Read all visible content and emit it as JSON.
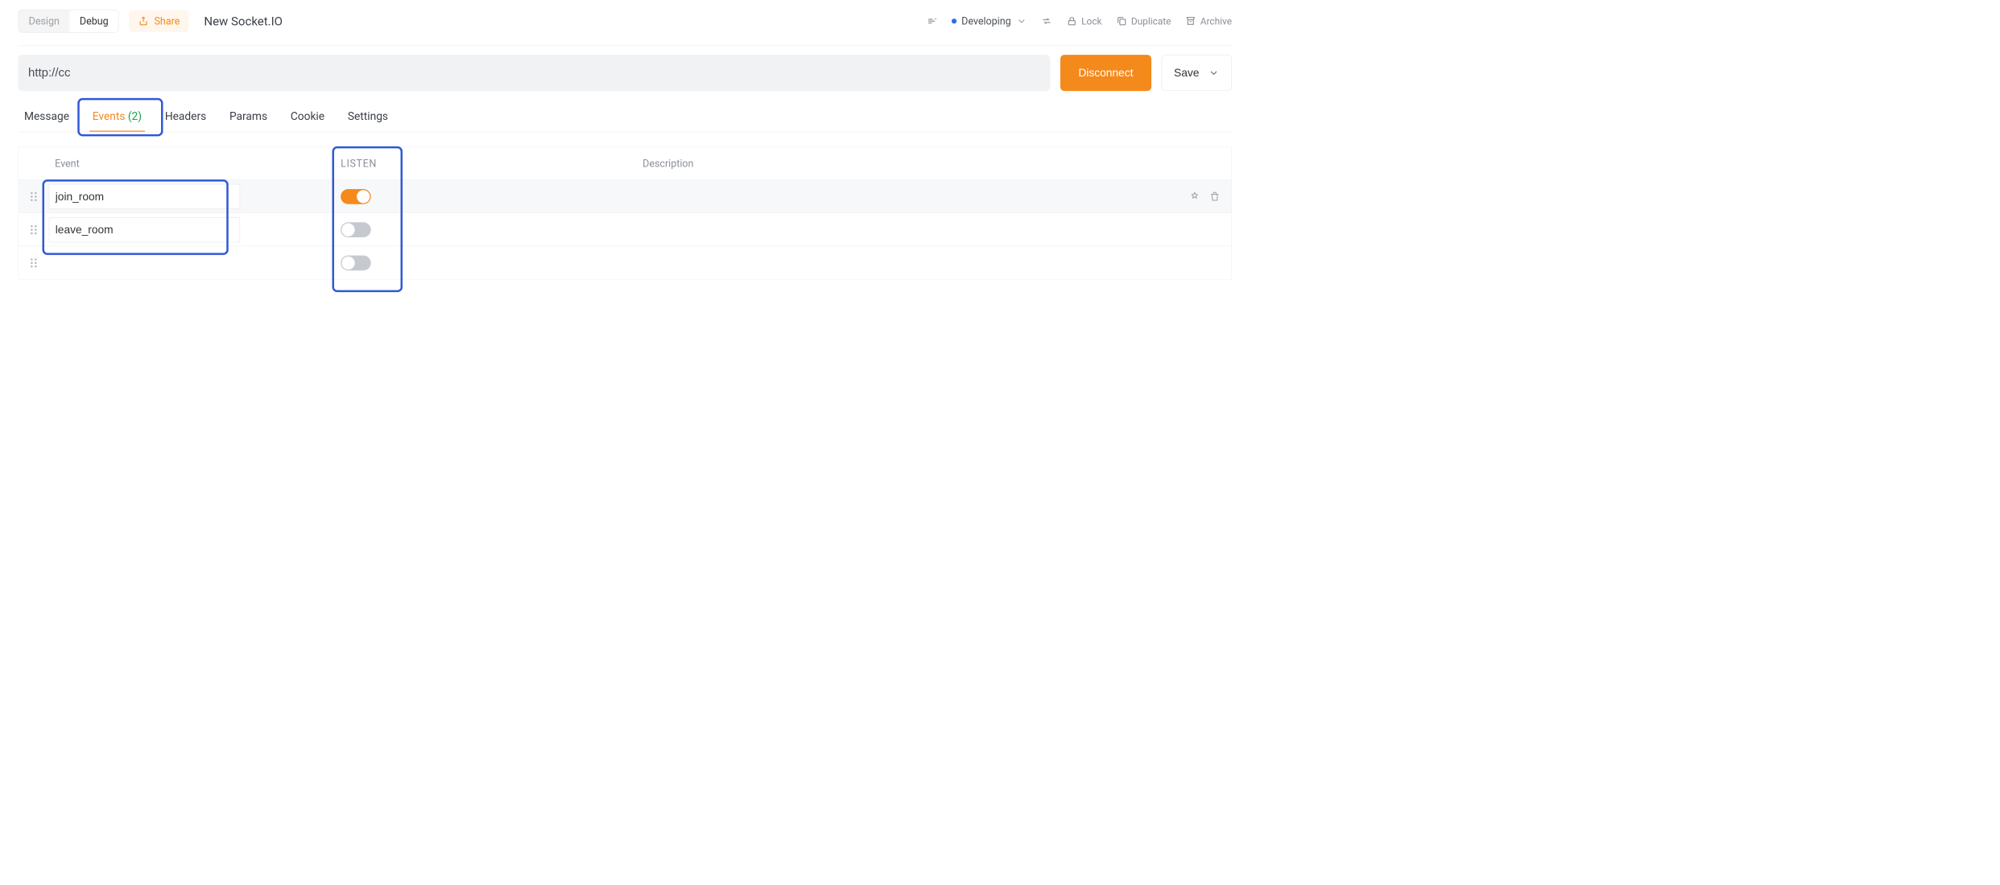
{
  "topbar": {
    "design_label": "Design",
    "debug_label": "Debug",
    "share_label": "Share",
    "title": "New Socket.IO"
  },
  "right": {
    "env_label": "Developing",
    "lock_label": "Lock",
    "duplicate_label": "Duplicate",
    "archive_label": "Archive"
  },
  "url": {
    "value": "http://cc",
    "disconnect_label": "Disconnect",
    "save_label": "Save"
  },
  "tabs": [
    {
      "label": "Message"
    },
    {
      "label": "Events",
      "count": "(2)",
      "active": true
    },
    {
      "label": "Headers"
    },
    {
      "label": "Params"
    },
    {
      "label": "Cookie"
    },
    {
      "label": "Settings"
    }
  ],
  "events_table": {
    "headers": {
      "event": "Event",
      "listen": "LISTEN",
      "description": "Description"
    },
    "rows": [
      {
        "event": "join_room",
        "listen": true,
        "hover": true
      },
      {
        "event": "leave_room",
        "listen": false
      },
      {
        "event": "",
        "listen": false,
        "empty": true
      }
    ]
  }
}
